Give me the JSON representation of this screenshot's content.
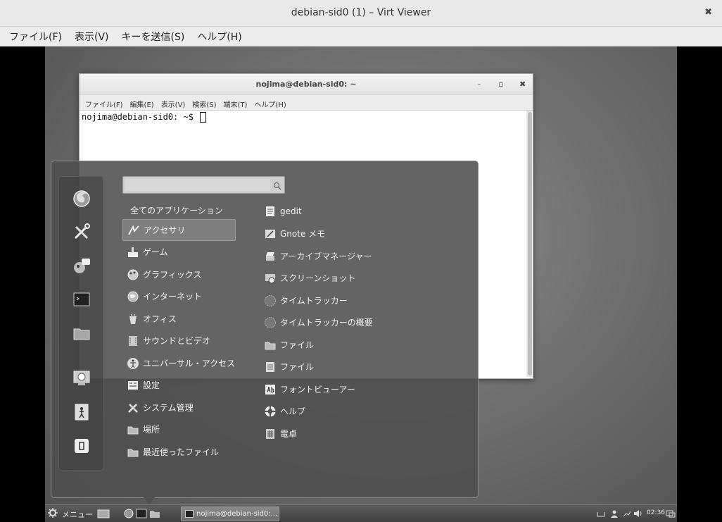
{
  "window": {
    "title": "debian-sid0 (1) – Virt Viewer",
    "close_glyph": "✖",
    "menu": [
      "ファイル(F)",
      "表示(V)",
      "キーを送信(S)",
      "ヘルプ(H)"
    ]
  },
  "terminal": {
    "title": "nojima@debian-sid0: ~",
    "controls": {
      "minimize": "-",
      "maximize": "▫",
      "close": "✖"
    },
    "menu": [
      "ファイル(F)",
      "編集(E)",
      "表示(V)",
      "検索(S)",
      "端末(T)",
      "ヘルプ(H)"
    ],
    "prompt": "nojima@debian-sid0: ~$ "
  },
  "app_menu": {
    "search": {
      "value": "",
      "placeholder": ""
    },
    "all_apps_label": "全てのアプリケーション",
    "favorites": [
      "firefox-icon",
      "system-tools-icon",
      "pidgin-icon",
      "terminal-icon",
      "folder-icon",
      "screensaver-icon",
      "logout-icon",
      "shutdown-icon"
    ],
    "categories": [
      {
        "label": "アクセサリ",
        "icon": "accessories-icon",
        "selected": true
      },
      {
        "label": "ゲーム",
        "icon": "games-icon"
      },
      {
        "label": "グラフィックス",
        "icon": "graphics-icon"
      },
      {
        "label": "インターネット",
        "icon": "internet-icon"
      },
      {
        "label": "オフィス",
        "icon": "office-icon"
      },
      {
        "label": "サウンドとビデオ",
        "icon": "sound-video-icon"
      },
      {
        "label": "ユニバーサル・アクセス",
        "icon": "universal-access-icon"
      },
      {
        "label": "設定",
        "icon": "settings-icon"
      },
      {
        "label": "システム管理",
        "icon": "system-admin-icon"
      },
      {
        "label": "場所",
        "icon": "places-icon"
      },
      {
        "label": "最近使ったファイル",
        "icon": "recent-files-icon"
      }
    ],
    "apps": [
      {
        "label": "gedit",
        "icon": "gedit-icon"
      },
      {
        "label": "Gnote メモ",
        "icon": "gnote-icon"
      },
      {
        "label": "アーカイブマネージャー",
        "icon": "archive-manager-icon"
      },
      {
        "label": "スクリーンショット",
        "icon": "screenshot-icon"
      },
      {
        "label": "タイムトラッカー",
        "icon": "time-tracker-icon"
      },
      {
        "label": "タイムトラッカーの概要",
        "icon": "time-tracker-overview-icon"
      },
      {
        "label": "ファイル",
        "icon": "files-icon"
      },
      {
        "label": "ファイル",
        "icon": "files-alt-icon"
      },
      {
        "label": "フォントビューアー",
        "icon": "font-viewer-icon"
      },
      {
        "label": "ヘルプ",
        "icon": "help-icon"
      },
      {
        "label": "電卓",
        "icon": "calculator-icon"
      }
    ]
  },
  "panel": {
    "menu_label": "メニュー",
    "task_label": "nojima@debian-sid0:...",
    "clock": "02:36"
  }
}
